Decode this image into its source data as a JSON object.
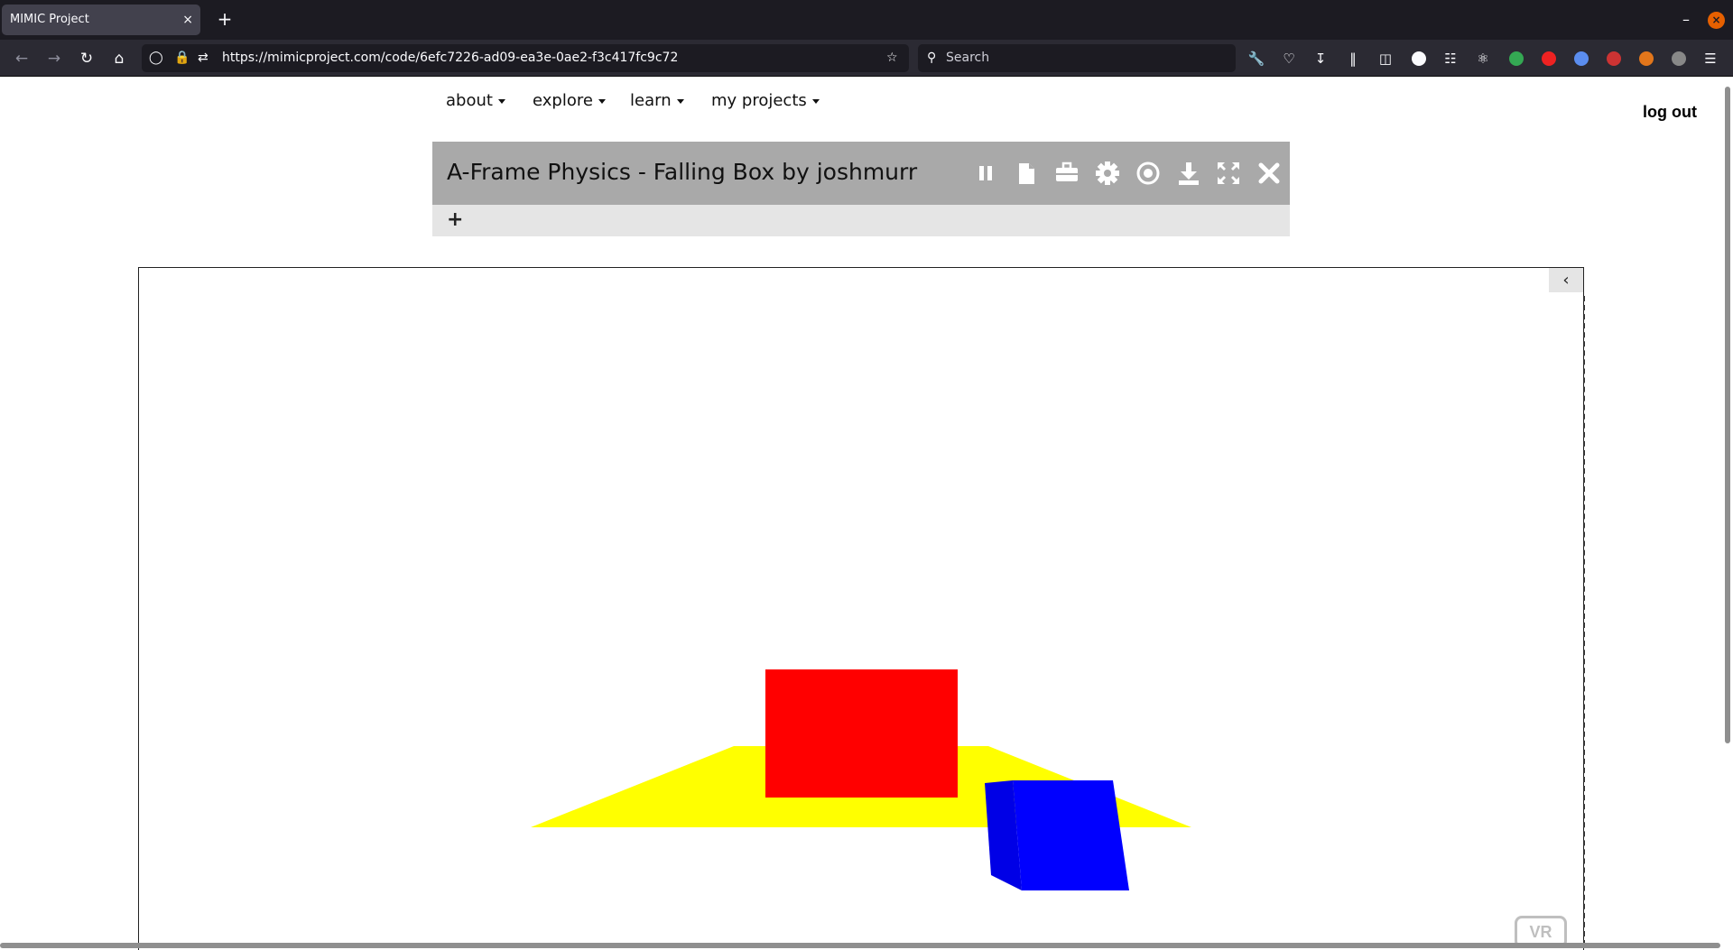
{
  "browser": {
    "tab_title": "MIMIC Project",
    "tab_close": "×",
    "new_tab": "+",
    "url": "https://mimicproject.com/code/6efc7226-ad09-ea3e-0ae2-f3c417fc9c72",
    "search_placeholder": "Search",
    "win_min": "–",
    "win_close": "×"
  },
  "site_nav": {
    "items": [
      {
        "label": "about"
      },
      {
        "label": "explore"
      },
      {
        "label": "learn"
      },
      {
        "label": "my projects"
      }
    ],
    "logout": "log out"
  },
  "project": {
    "title": "A-Frame Physics - Falling Box by joshmurr",
    "add_label": "+"
  },
  "scene": {
    "collapse_label": "‹",
    "vr_label": "VR",
    "colors": {
      "plane": "#ffff00",
      "red_box": "#ff0000",
      "blue_box": "#0000ff"
    }
  },
  "toolbar_icons": [
    "pause-icon",
    "document-icon",
    "briefcase-icon",
    "gear-icon",
    "record-icon",
    "download-icon",
    "fullscreen-icon",
    "close-icon"
  ]
}
